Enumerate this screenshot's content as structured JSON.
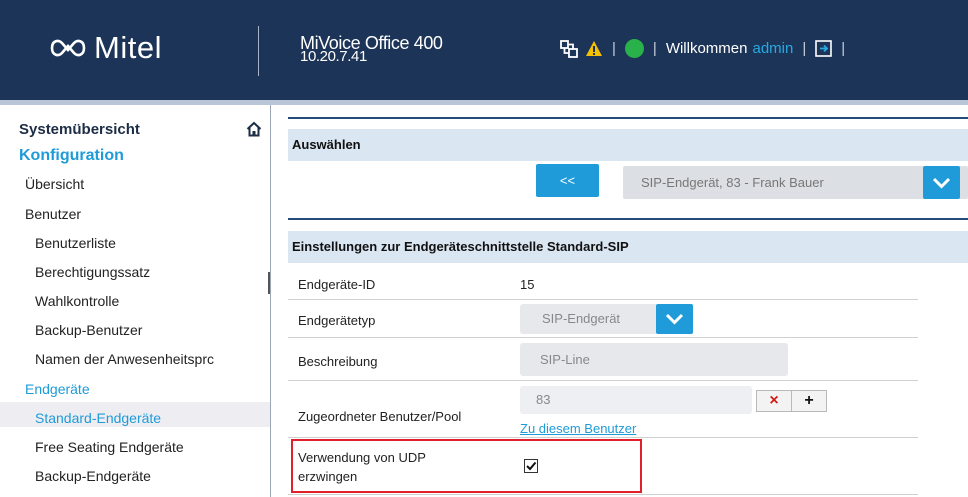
{
  "header": {
    "brand": "Mitel",
    "product_name": "MiVoice Office 400",
    "product_ip": "10.20.7.41",
    "welcome_text": "Willkommen",
    "username": "admin",
    "separator": "|",
    "status_color": "#29b24a",
    "warning_color": "#f5c000",
    "icons": [
      "network-icon",
      "warning-icon",
      "status-indicator",
      "logout-icon"
    ]
  },
  "sidebar": {
    "title": "Systemübersicht",
    "section": "Konfiguration",
    "items": [
      {
        "label": "Übersicht"
      },
      {
        "label": "Benutzer"
      },
      {
        "label": "Benutzerliste"
      },
      {
        "label": "Berechtigungssatz"
      },
      {
        "label": "Wahlkontrolle"
      },
      {
        "label": "Backup-Benutzer"
      },
      {
        "label": "Namen der Anwesenheitsprc"
      },
      {
        "label": "Endgeräte"
      },
      {
        "label": "Standard-Endgeräte"
      },
      {
        "label": "Free Seating Endgeräte"
      },
      {
        "label": "Backup-Endgeräte"
      }
    ]
  },
  "select_section": {
    "title": "Auswählen",
    "back_label": "<<",
    "selected_terminal": "SIP-Endgerät, 83 - Frank Bauer"
  },
  "settings": {
    "title": "Einstellungen zur Endgeräteschnittstelle Standard-SIP",
    "terminal_id_label": "Endgeräte-ID",
    "terminal_id_value": "15",
    "terminal_type_label": "Endgerätetyp",
    "terminal_type_value": "SIP-Endgerät",
    "description_label": "Beschreibung",
    "description_value": "SIP-Line",
    "assigned_user_label": "Zugeordneter Benutzer/Pool",
    "assigned_user_value": "83",
    "delete_label": "×",
    "add_label": "+",
    "user_link": "Zu diesem Benutzer",
    "udp_label_line1": "Verwendung von UDP",
    "udp_label_line2": "erzwingen",
    "udp_checked": true
  },
  "colors": {
    "header_bg": "#1c3458",
    "accent": "#1e9bd8",
    "section_bg": "#dbe6f3",
    "highlight": "#e0202b"
  }
}
